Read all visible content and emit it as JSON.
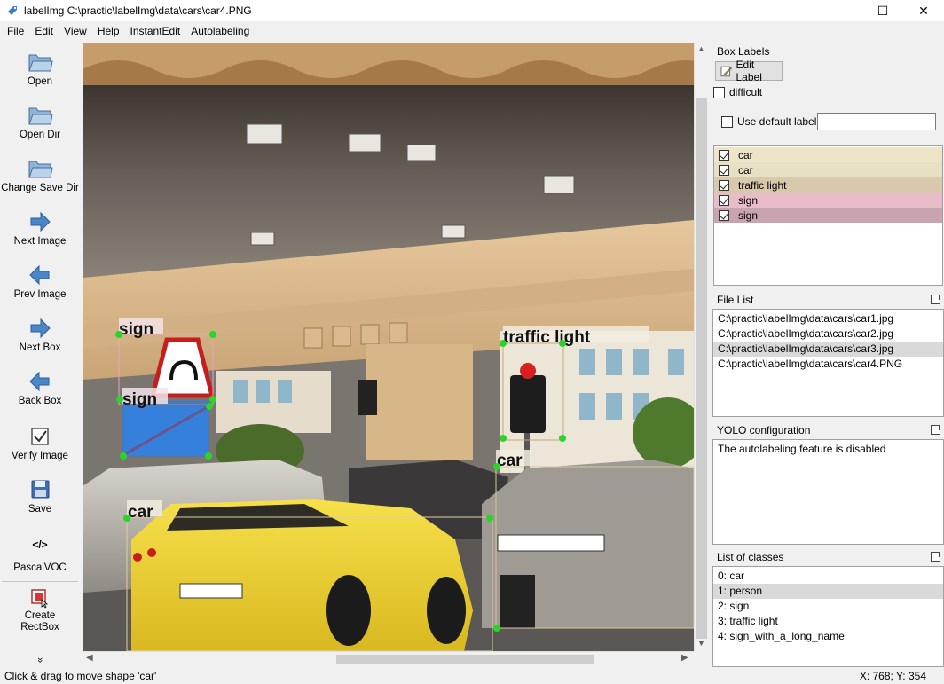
{
  "window": {
    "title": "labelImg C:\\practic\\labelImg\\data\\cars\\car4.PNG",
    "minimize": "—",
    "maximize": "☐",
    "close": "✕"
  },
  "menu": [
    {
      "label": "File"
    },
    {
      "label": "Edit"
    },
    {
      "label": "View"
    },
    {
      "label": "Help"
    },
    {
      "label": "InstantEdit"
    },
    {
      "label": "Autolabeling"
    }
  ],
  "toolbar": {
    "open": "Open",
    "open_dir": "Open Dir",
    "change_save_dir": "Change Save Dir",
    "next_image": "Next Image",
    "prev_image": "Prev Image",
    "next_box": "Next Box",
    "back_box": "Back Box",
    "verify_image": "Verify Image",
    "save": "Save",
    "format": "PascalVOC",
    "format_icon": "</>",
    "create_rectbox": "Create\nRectBox",
    "more": "»"
  },
  "canvas": {
    "boxes": [
      {
        "label": "sign"
      },
      {
        "label": "sign"
      },
      {
        "label": "traffic light"
      },
      {
        "label": "car"
      },
      {
        "label": "car"
      }
    ]
  },
  "box_labels": {
    "title": "Box Labels",
    "edit_label": "Edit Label",
    "difficult": "difficult",
    "use_default_label": "Use default label",
    "default_label_value": "",
    "items": [
      {
        "label": "car",
        "checked": true,
        "color": "#eee4c8"
      },
      {
        "label": "car",
        "checked": true,
        "color": "#e8e0c4"
      },
      {
        "label": "traffic light",
        "checked": true,
        "color": "#d8c8ac"
      },
      {
        "label": "sign",
        "checked": true,
        "color": "#e8bcc8"
      },
      {
        "label": "sign",
        "checked": true,
        "color": "#c8a4b0"
      }
    ]
  },
  "file_list": {
    "title": "File List",
    "files": [
      "C:\\practic\\labelImg\\data\\cars\\car1.jpg",
      "C:\\practic\\labelImg\\data\\cars\\car2.jpg",
      "C:\\practic\\labelImg\\data\\cars\\car3.jpg",
      "C:\\practic\\labelImg\\data\\cars\\car4.PNG"
    ],
    "selected_index": 2
  },
  "yolo": {
    "title": "YOLO configuration",
    "message": "The autolabeling feature is disabled"
  },
  "classes": {
    "title": "List of classes",
    "items": [
      "0: car",
      "1: person",
      "2: sign",
      "3: traffic light",
      "4: sign_with_a_long_name"
    ],
    "selected_index": 1
  },
  "status": {
    "message": "Click & drag to move shape 'car'",
    "coords": "X: 768; Y: 354"
  }
}
